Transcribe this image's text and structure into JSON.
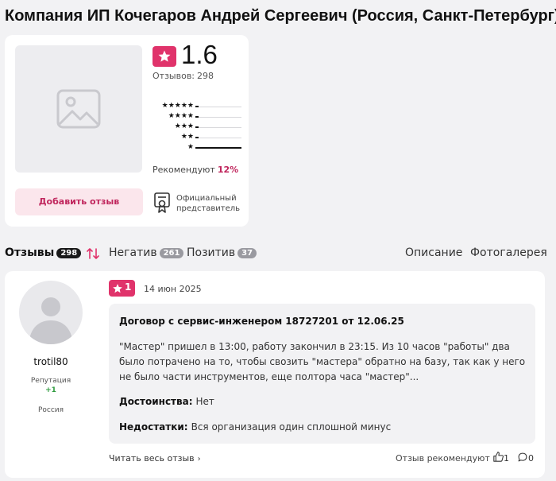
{
  "page_title": "Компания ИП Кочегаров Андрей Сергеевич (Россия, Санкт-Петербург) - отзывы",
  "company": {
    "rating": "1.6",
    "reviews_label": "Отзывов:",
    "reviews_count": "298",
    "distribution": [
      {
        "stars": "★★★★★",
        "fraction": 0.0
      },
      {
        "stars": "★★★★",
        "fraction": 0.0
      },
      {
        "stars": "★★★",
        "fraction": 0.0
      },
      {
        "stars": "★★",
        "fraction": 0.0
      },
      {
        "stars": "★",
        "fraction": 1.0
      }
    ],
    "recommend_label": "Рекомендуют",
    "recommend_pct": "12%",
    "add_review_label": "Добавить отзыв",
    "official_label": "Официальный представитель"
  },
  "tabs": {
    "reviews_label": "Отзывы",
    "reviews_count": "298",
    "negative_label": "Негатив",
    "negative_count": "261",
    "positive_label": "Позитив",
    "positive_count": "37",
    "description_label": "Описание",
    "gallery_label": "Фотогалерея"
  },
  "review": {
    "author": "trotil80",
    "reputation_label": "Репутация",
    "reputation_value": "+1",
    "country": "Россия",
    "rating": "1",
    "date": "14 июн 2025",
    "title": "Договор с сервис-инженером 18727201 от 12.06.25",
    "text": "\"Мастер\" пришел в 13:00, работу закончил в 23:15. Из 10 часов \"работы\" два было потрачено на то, чтобы свозить \"мастера\" обратно на базу, так как у него не было части инструментов, еще полтора часа \"мастер\"...",
    "pros_label": "Достоинства:",
    "pros": "Нет",
    "cons_label": "Недостатки:",
    "cons": "Вся организация один сплошной минус",
    "read_more": "Читать весь отзыв",
    "recommended": "Отзыв рекомендуют",
    "likes": "1",
    "comments": "0"
  },
  "colors": {
    "accent": "#e0336b",
    "accent_light": "#fbe6ec",
    "background": "#f2f2f4",
    "positive": "#2e9b3e"
  }
}
